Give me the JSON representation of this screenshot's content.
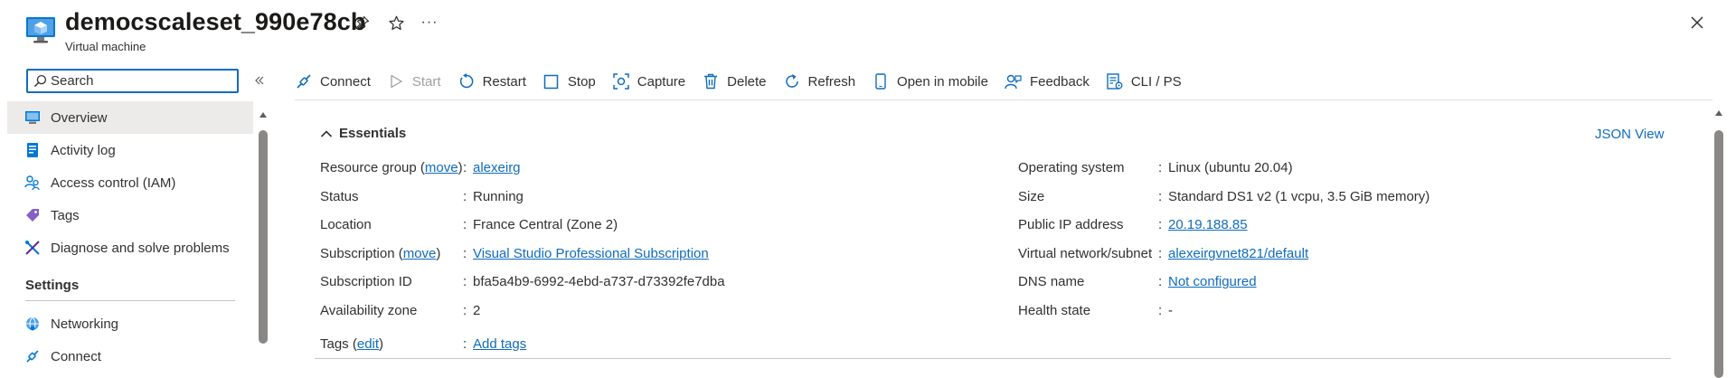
{
  "header": {
    "title": "democscaleset_990e78cb",
    "subtitle": "Virtual machine",
    "icons": [
      "pin-icon",
      "star-icon",
      "ellipsis-icon",
      "close-icon"
    ],
    "more_glyph": "···"
  },
  "sidebar": {
    "search_placeholder": "Search",
    "items": [
      {
        "label": "Overview",
        "icon": "overview-icon",
        "active": true
      },
      {
        "label": "Activity log",
        "icon": "activity-log-icon"
      },
      {
        "label": "Access control (IAM)",
        "icon": "iam-icon"
      },
      {
        "label": "Tags",
        "icon": "tag-icon"
      },
      {
        "label": "Diagnose and solve problems",
        "icon": "diagnose-icon"
      }
    ],
    "section_settings": "Settings",
    "settings_items": [
      {
        "label": "Networking",
        "icon": "networking-icon"
      },
      {
        "label": "Connect",
        "icon": "connect-icon"
      }
    ]
  },
  "toolbar": {
    "connect": "Connect",
    "start": "Start",
    "restart": "Restart",
    "stop": "Stop",
    "capture": "Capture",
    "delete": "Delete",
    "refresh": "Refresh",
    "open_in_mobile": "Open in mobile",
    "feedback": "Feedback",
    "cli_ps": "CLI / PS"
  },
  "essentials": {
    "title": "Essentials",
    "json_view": "JSON View",
    "left": {
      "resource_group_label": "Resource group",
      "move1": "move",
      "resource_group_value": "alexeirg",
      "status_label": "Status",
      "status_value": "Running",
      "location_label": "Location",
      "location_value": "France Central (Zone 2)",
      "subscription_label": "Subscription",
      "move2": "move",
      "subscription_value": "Visual Studio Professional Subscription",
      "subscription_id_label": "Subscription ID",
      "subscription_id_value": "bfa5a4b9-6992-4ebd-a737-d73392fe7dba",
      "availability_zone_label": "Availability zone",
      "availability_zone_value": "2",
      "tags_label": "Tags",
      "edit": "edit",
      "tags_value": "Add tags"
    },
    "right": {
      "os_label": "Operating system",
      "os_value": "Linux (ubuntu 20.04)",
      "size_label": "Size",
      "size_value": "Standard DS1 v2 (1 vcpu, 3.5 GiB memory)",
      "public_ip_label": "Public IP address",
      "public_ip_value": "20.19.188.85",
      "vnet_label": "Virtual network/subnet",
      "vnet_value": "alexeirgvnet821/default",
      "dns_label": "DNS name",
      "dns_value": "Not configured",
      "health_label": "Health state",
      "health_value": "-"
    }
  },
  "colors": {
    "accent": "#0f6cbd",
    "text": "#323130",
    "active_bg": "#edebe9"
  }
}
